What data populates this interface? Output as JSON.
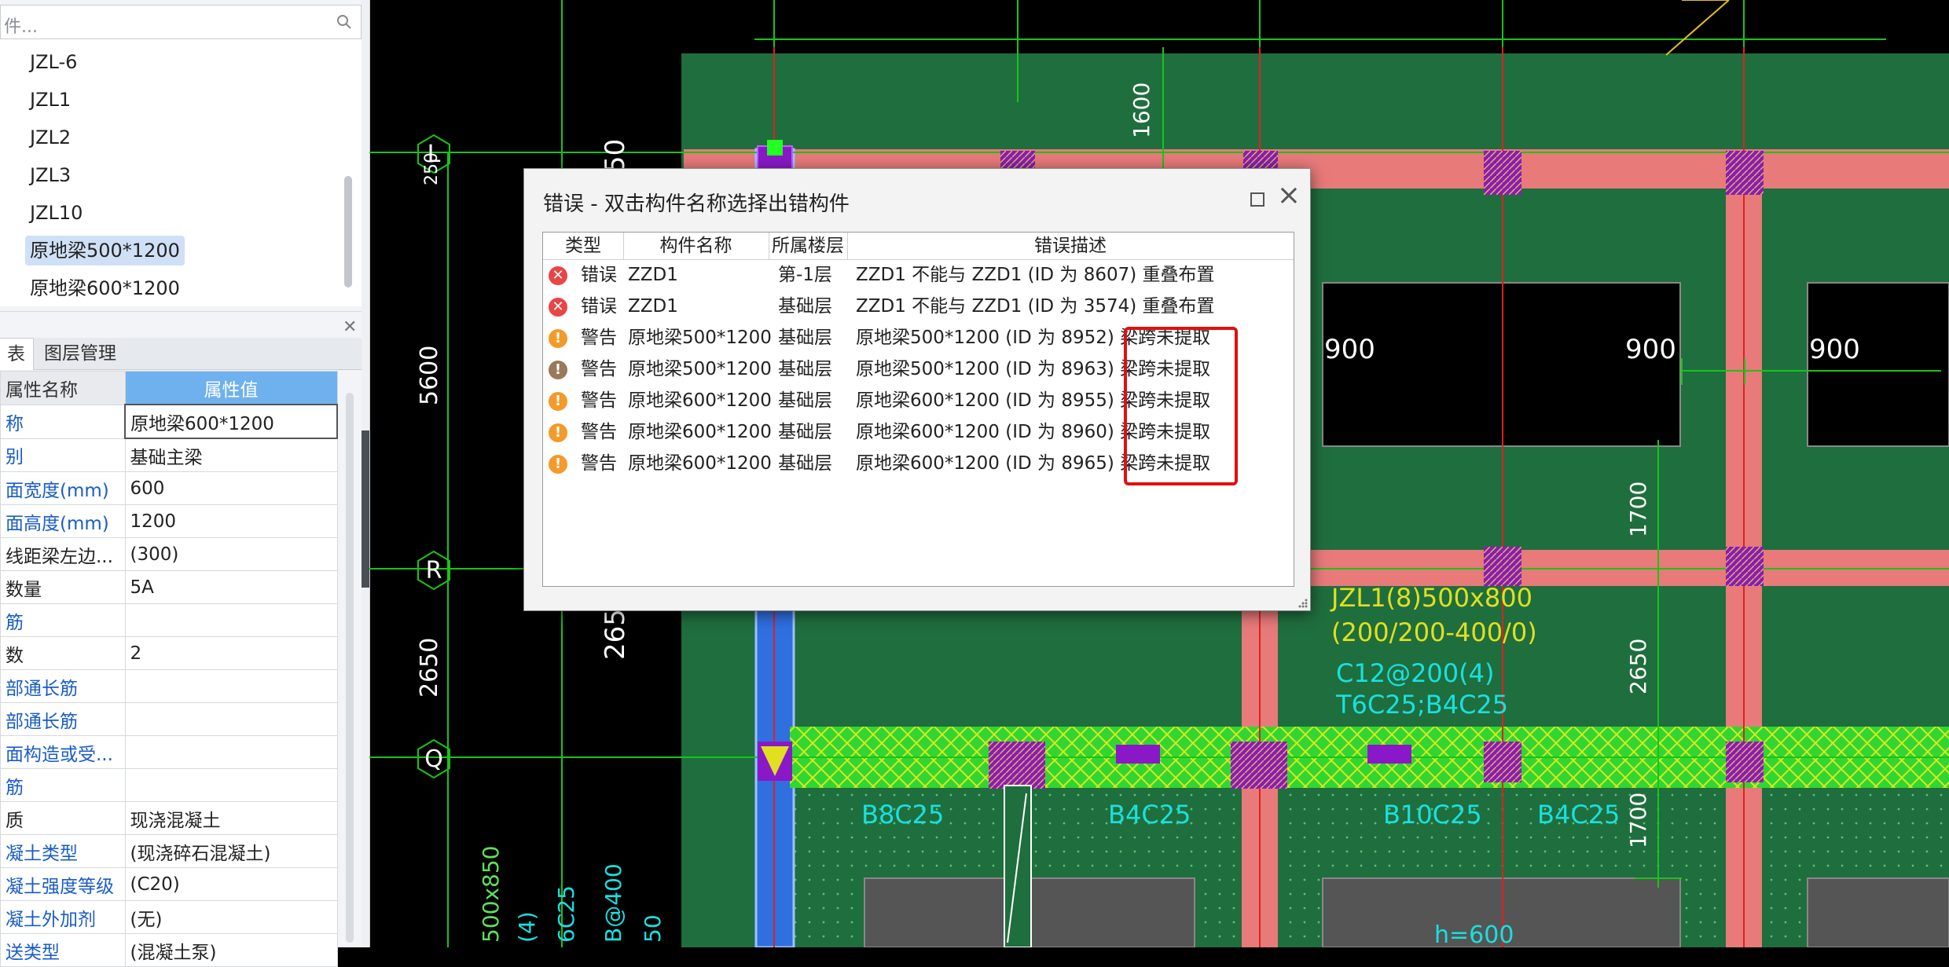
{
  "left_panel": {
    "search_placeholder": "件...",
    "tree_items": [
      "JZL-6",
      "JZL1",
      "JZL2",
      "JZL3",
      "JZL10",
      "原地梁500*1200",
      "原地梁600*1200"
    ],
    "selected_item": "原地梁500*1200",
    "tabs": [
      "表",
      "图层管理"
    ],
    "property_table": {
      "headers": [
        "属性名称",
        "属性值"
      ],
      "rows": [
        {
          "name": "称",
          "value": "原地梁600*1200"
        },
        {
          "name": "别",
          "value": "基础主梁"
        },
        {
          "name": "面宽度(mm)",
          "value": "600"
        },
        {
          "name": "面高度(mm)",
          "value": "1200"
        },
        {
          "name": "线距梁左边...",
          "value": "(300)"
        },
        {
          "name": "数量",
          "value": "5A"
        },
        {
          "name": "筋",
          "value": ""
        },
        {
          "name": "数",
          "value": "2"
        },
        {
          "name": "部通长筋",
          "value": ""
        },
        {
          "name": "部通长筋",
          "value": ""
        },
        {
          "name": "面构造或受...",
          "value": ""
        },
        {
          "name": "筋",
          "value": ""
        },
        {
          "name": "质",
          "value": "现浇混凝土"
        },
        {
          "name": "凝土类型",
          "value": "(现浇碎石混凝土)"
        },
        {
          "name": "凝土强度等级",
          "value": "(C20)"
        },
        {
          "name": "凝土外加剂",
          "value": "(无)"
        },
        {
          "name": "送类型",
          "value": "(混凝土泵)"
        }
      ]
    }
  },
  "cad": {
    "grid_labels": [
      "L",
      "R",
      "Q"
    ],
    "dims": [
      "1600",
      "5600",
      "2650",
      "2650",
      "1700",
      "2650",
      "1700",
      "900",
      "900",
      "900",
      "50",
      "250"
    ],
    "beam_annotation": [
      "JZL1(8)500x800",
      "(200/200-400/0)",
      "C12@200(4)",
      "T6C25;B4C25"
    ],
    "rebar_labels": [
      "B8C25",
      "B4C25",
      "B10C25",
      "B4C25"
    ],
    "misc_labels": [
      "500x850",
      "(4)",
      "6C25",
      "B@400",
      "50",
      "h=600"
    ]
  },
  "dialog": {
    "title": "错误 - 双击构件名称选择出错构件",
    "columns": [
      "类型",
      "构件名称",
      "所属楼层",
      "错误描述"
    ],
    "rows": [
      {
        "type": "错误",
        "level": "error",
        "name": "ZZD1",
        "floor": "第-1层",
        "desc": "ZZD1 不能与 ZZD1 (ID 为 8607) 重叠布置"
      },
      {
        "type": "错误",
        "level": "error",
        "name": "ZZD1",
        "floor": "基础层",
        "desc": "ZZD1 不能与 ZZD1 (ID 为 3574) 重叠布置"
      },
      {
        "type": "警告",
        "level": "warning",
        "name": "原地梁500*1200",
        "floor": "基础层",
        "desc": "原地梁500*1200 (ID 为 8952) 梁跨未提取"
      },
      {
        "type": "警告",
        "level": "warning",
        "name": "原地梁500*1200",
        "floor": "基础层",
        "desc": "原地梁500*1200 (ID 为 8963) 梁跨未提取"
      },
      {
        "type": "警告",
        "level": "warning",
        "name": "原地梁600*1200",
        "floor": "基础层",
        "desc": "原地梁600*1200 (ID 为 8955) 梁跨未提取"
      },
      {
        "type": "警告",
        "level": "warning",
        "name": "原地梁600*1200",
        "floor": "基础层",
        "desc": "原地梁600*1200 (ID 为 8960) 梁跨未提取"
      },
      {
        "type": "警告",
        "level": "warning",
        "name": "原地梁600*1200",
        "floor": "基础层",
        "desc": "原地梁600*1200 (ID 为 8965) 梁跨未提取"
      }
    ]
  },
  "colors": {
    "cad_background": "#000000",
    "slab_green": "#1f6e3e",
    "beam_red": "#e87a7a",
    "beam_yellow": "#d9e81f",
    "column_purple": "#8a18c8",
    "grid_green": "#19c419",
    "highlight_red": "#e01010"
  }
}
